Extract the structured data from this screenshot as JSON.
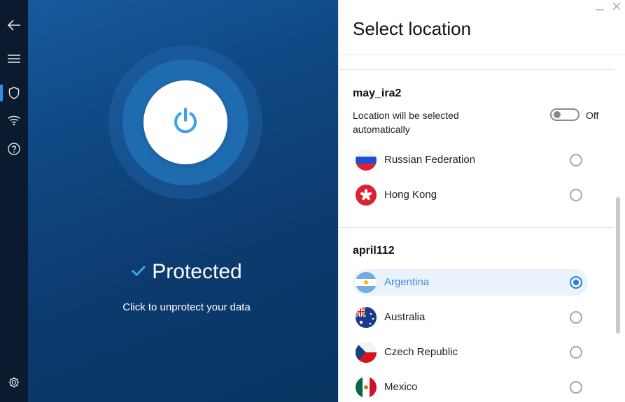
{
  "rail": {
    "items": [
      {
        "name": "back-icon"
      },
      {
        "name": "menu-icon"
      },
      {
        "name": "shield-icon",
        "active": true
      },
      {
        "name": "wifi-icon"
      },
      {
        "name": "help-icon"
      },
      {
        "name": "gear-icon"
      }
    ],
    "active_color": "#2f8de4"
  },
  "main": {
    "status": "Protected",
    "hint": "Click to unprotect your data",
    "power_icon": "power-icon",
    "check_icon": "check-icon",
    "accent": "#3aa3ec"
  },
  "panel": {
    "title": "Select location",
    "groups": [
      {
        "title": "may_ira2",
        "auto_select": {
          "text": "Location will be selected automatically",
          "toggle_label": "Off",
          "on": false
        },
        "locations": [
          {
            "name": "Russian Federation",
            "flag": "ru",
            "selected": false
          },
          {
            "name": "Hong Kong",
            "flag": "hk",
            "selected": false
          }
        ]
      },
      {
        "title": "april112",
        "locations": [
          {
            "name": "Argentina",
            "flag": "ar",
            "selected": true
          },
          {
            "name": "Australia",
            "flag": "au",
            "selected": false
          },
          {
            "name": "Czech Republic",
            "flag": "cz",
            "selected": false
          },
          {
            "name": "Mexico",
            "flag": "mx",
            "selected": false
          }
        ]
      }
    ],
    "window_controls": [
      "minimize-icon",
      "close-icon"
    ],
    "selected_color": "#2f80d6"
  }
}
